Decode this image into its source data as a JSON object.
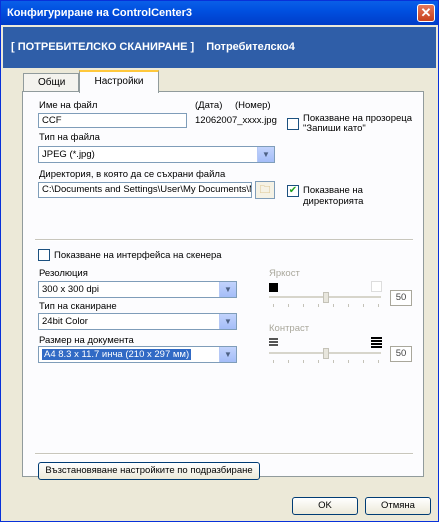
{
  "window": {
    "title": "Конфигуриране на ControlCenter3",
    "close_glyph": "✕"
  },
  "header": {
    "left": "[ ПОТРЕБИТЕЛСКО СКАНИРАНЕ ]",
    "right": "Потребителско4"
  },
  "tabs": [
    {
      "label": "Общи"
    },
    {
      "label": "Настройки"
    }
  ],
  "file": {
    "name_label": "Име на файл",
    "date_label": "(Дата)",
    "number_label": "(Номер)",
    "name_value": "CCF",
    "suffix": "12062007_xxxx.jpg",
    "save_as_label": "Показване на прозореца \"Запиши като\"",
    "save_as_checked": false,
    "type_label": "Тип на файла",
    "type_value": "JPEG (*.jpg)",
    "dir_label": "Директория, в която да се съхрани файла",
    "dir_value": "C:\\Documents and Settings\\User\\My Documents\\My",
    "show_dir_label": "Показване на директорията",
    "show_dir_checked": true
  },
  "scanner": {
    "show_interface_label": "Показване на интерфейса на скенера",
    "show_interface_checked": false,
    "resolution_label": "Резолюция",
    "resolution_value": "300 x 300 dpi",
    "scan_type_label": "Тип на сканиране",
    "scan_type_value": "24bit Color",
    "doc_size_label": "Размер на документа",
    "doc_size_value": "A4 8.3 x 11.7 инча (210 x 297 мм)",
    "brightness_label": "Яркост",
    "brightness_value": "50",
    "contrast_label": "Контраст",
    "contrast_value": "50"
  },
  "buttons": {
    "restore_defaults": "Възстановяване настройките по подразбиране",
    "ok": "OK",
    "cancel": "Отмяна"
  },
  "icons": {
    "checkmark": "✔",
    "dropdown": "▼",
    "folder": "🗀"
  }
}
